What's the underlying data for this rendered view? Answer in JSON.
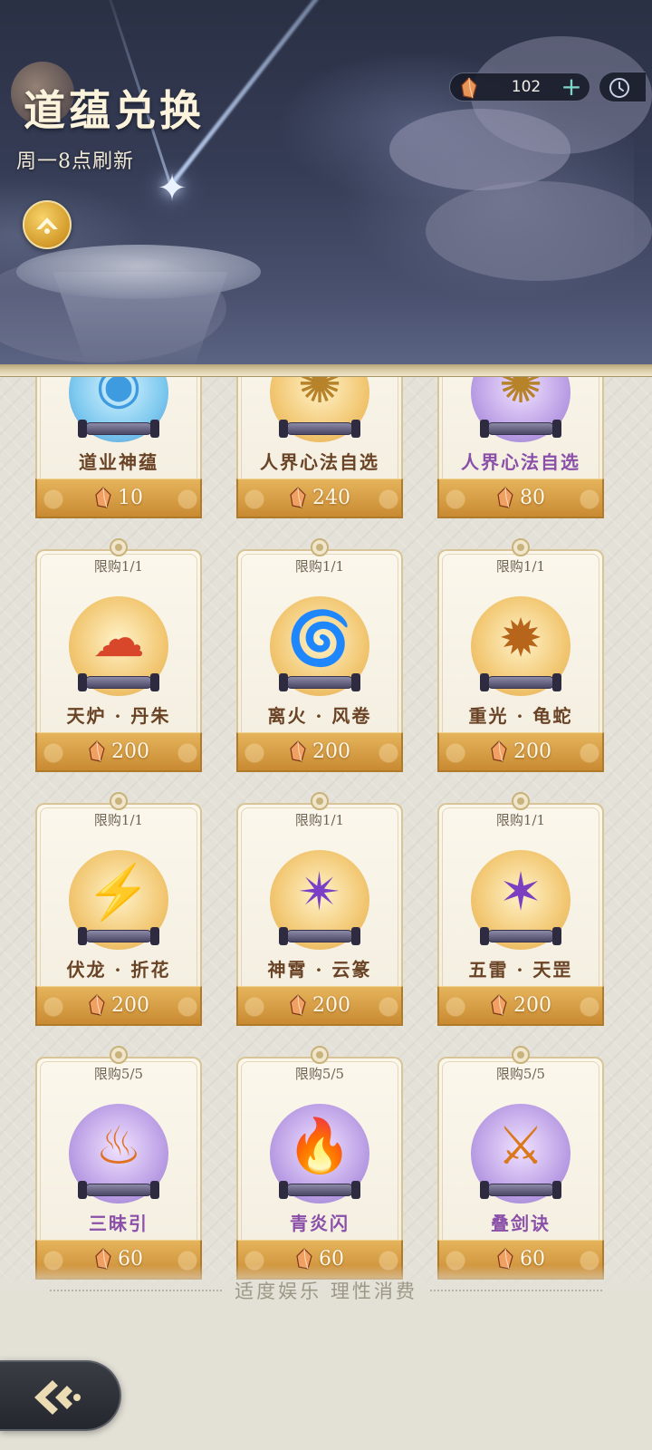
{
  "header": {
    "title": "道蕴兑换",
    "refresh_note": "周一8点刷新",
    "currency": {
      "icon": "ember-crystal-icon",
      "value": "102",
      "add_label": "+"
    },
    "history_icon": "clock-icon",
    "emblem_icon": "ascend-emblem-icon"
  },
  "colors": {
    "accent_gold": "#d39a2a",
    "price_bar": "#c98a32",
    "name_brown": "#6a4326",
    "name_purple": "#8a4fa8",
    "sky": "#353c55"
  },
  "items": [
    {
      "limit": "",
      "name": "道业神蕴",
      "price": "10",
      "orb": "blue",
      "name_color": "brown",
      "icon": "spirit-orb-icon"
    },
    {
      "limit": "",
      "name": "人界心法自选",
      "price": "240",
      "orb": "gold",
      "name_color": "brown",
      "icon": "golden-tome-icon"
    },
    {
      "limit": "",
      "name": "人界心法自选",
      "price": "80",
      "orb": "purple",
      "name_color": "purple",
      "icon": "golden-tome-icon"
    },
    {
      "limit": "限购1/1",
      "name": "天炉 · 丹朱",
      "price": "200",
      "orb": "gold",
      "name_color": "brown",
      "icon": "flame-cloud-icon"
    },
    {
      "limit": "限购1/1",
      "name": "离火 · 风卷",
      "price": "200",
      "orb": "gold",
      "name_color": "brown",
      "icon": "fire-tornado-icon"
    },
    {
      "limit": "限购1/1",
      "name": "重光 · 龟蛇",
      "price": "200",
      "orb": "gold",
      "name_color": "brown",
      "icon": "light-burst-icon"
    },
    {
      "limit": "限购1/1",
      "name": "伏龙 · 折花",
      "price": "200",
      "orb": "gold",
      "name_color": "brown",
      "icon": "golden-blades-icon"
    },
    {
      "limit": "限购1/1",
      "name": "神霄 · 云篆",
      "price": "200",
      "orb": "gold",
      "name_color": "brown",
      "icon": "purple-lightning-icon"
    },
    {
      "limit": "限购1/1",
      "name": "五雷 · 天罡",
      "price": "200",
      "orb": "gold",
      "name_color": "brown",
      "icon": "thunder-stars-icon"
    },
    {
      "limit": "限购5/5",
      "name": "三昧引",
      "price": "60",
      "orb": "purple",
      "name_color": "purple",
      "icon": "flame-claw-icon"
    },
    {
      "limit": "限购5/5",
      "name": "青炎闪",
      "price": "60",
      "orb": "purple",
      "name_color": "purple",
      "icon": "red-flame-icon"
    },
    {
      "limit": "限购5/5",
      "name": "叠剑诀",
      "price": "60",
      "orb": "purple",
      "name_color": "purple",
      "icon": "twin-swords-icon"
    }
  ],
  "footer": {
    "notice": "适度娱乐 理性消费",
    "back_icon": "back-arrow-icon"
  }
}
